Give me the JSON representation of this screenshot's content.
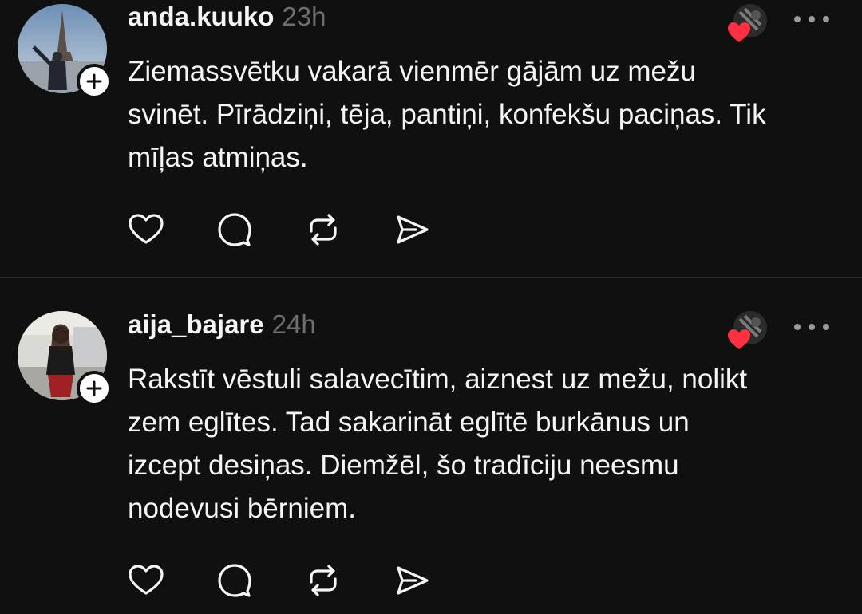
{
  "colors": {
    "background": "#101010",
    "text": "#f3f5f7",
    "muted": "#6f6f6f",
    "heart": "#ff3040",
    "divider": "#2d2d2d"
  },
  "posts": [
    {
      "username": "anda.kuuko",
      "time": "23h",
      "lines": [
        "Ziemassvētku vakarā vienmēr gājām uz mežu",
        "svinēt. Pīrādziņi, tēja, pantiņi, konfekšu paciņas. Tik",
        "mīļas atmiņas."
      ],
      "icons": {
        "follow": "plus-icon",
        "liked_by": "heart-icon",
        "more": "more-icon",
        "actions": [
          "heart-icon",
          "comment-icon",
          "repost-icon",
          "share-icon"
        ]
      }
    },
    {
      "username": "aija_bajare",
      "time": "24h",
      "lines": [
        "Rakstīt vēstuli salavecītim, aiznest uz mežu, nolikt",
        "zem eglītes. Tad sakarināt eglītē burkānus un",
        "izcept desiņas. Diemžēl, šo tradīciju neesmu",
        "nodevusi bērniem."
      ],
      "icons": {
        "follow": "plus-icon",
        "liked_by": "heart-icon",
        "more": "more-icon",
        "actions": [
          "heart-icon",
          "comment-icon",
          "repost-icon",
          "share-icon"
        ]
      }
    }
  ]
}
